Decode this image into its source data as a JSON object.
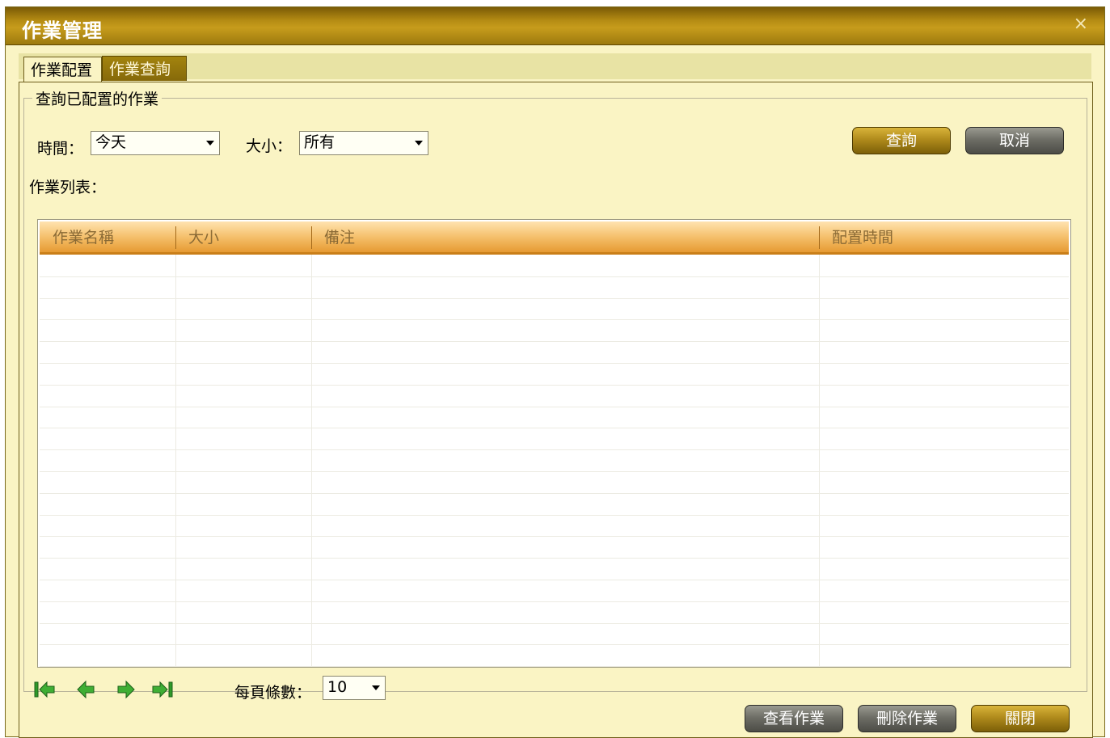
{
  "window": {
    "title": "作業管理",
    "close_glyph": "×"
  },
  "tabs": [
    {
      "label": "作業配置",
      "active": false
    },
    {
      "label": "作業查詢",
      "active": true
    }
  ],
  "group": {
    "legend": "查詢已配置的作業"
  },
  "filters": {
    "time_label": "時間：",
    "time_value": "今天",
    "size_label": "大小：",
    "size_value": "所有"
  },
  "buttons": {
    "query": "查詢",
    "cancel": "取消",
    "view_job": "查看作業",
    "delete_job": "刪除作業",
    "close": "關閉"
  },
  "list": {
    "label": "作業列表：",
    "columns": [
      "作業名稱",
      "大小",
      "備注",
      "配置時間"
    ],
    "rows": []
  },
  "pagination": {
    "per_page_label": "每頁條數：",
    "per_page_value": "10",
    "icons": [
      "first-page-icon",
      "prev-page-icon",
      "next-page-icon",
      "last-page-icon"
    ]
  },
  "colors": {
    "title_gold": "#b48b13",
    "panel_bg": "#faf4c4",
    "header_orange": "#f5c06c",
    "nav_green": "#2f9a2a"
  }
}
